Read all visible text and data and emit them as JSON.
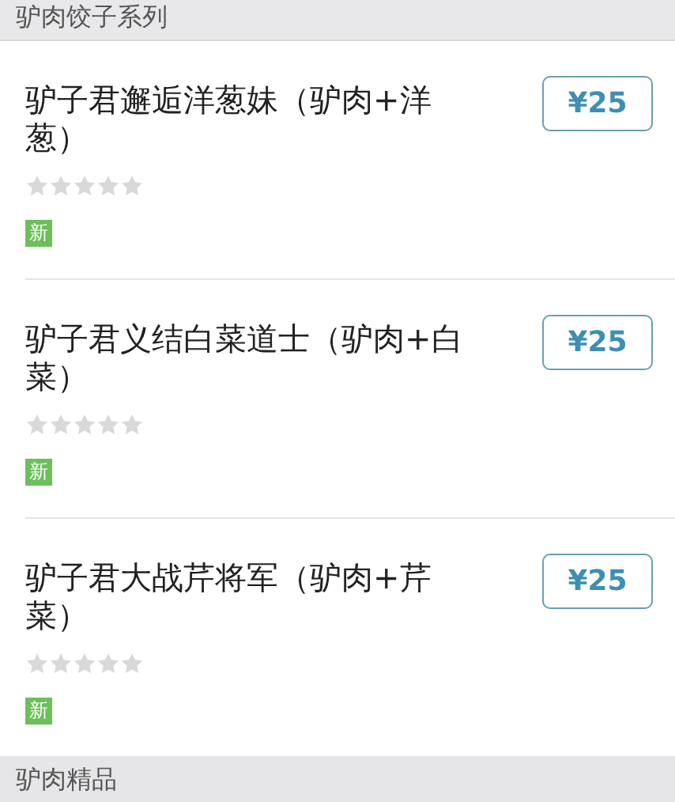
{
  "sections": [
    {
      "title": "驴肉饺子系列",
      "items": [
        {
          "name": "驴子君邂逅洋葱妹（驴肉+洋葱）",
          "stars": 0,
          "badge": "新",
          "price": "¥25"
        },
        {
          "name": "驴子君义结白菜道士（驴肉+白菜）",
          "stars": 0,
          "badge": "新",
          "price": "¥25"
        },
        {
          "name": "驴子君大战芹将军（驴肉+芹菜）",
          "stars": 0,
          "badge": "新",
          "price": "¥25"
        }
      ]
    },
    {
      "title": "驴肉精品"
    }
  ]
}
